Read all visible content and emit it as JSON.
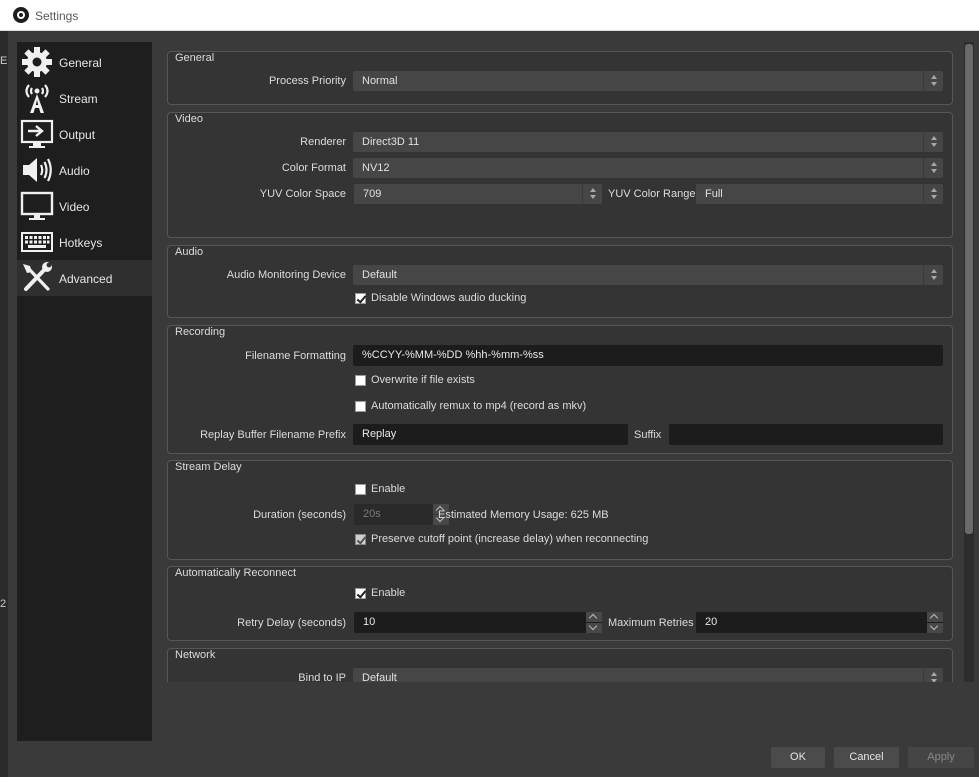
{
  "window": {
    "title": "Settings"
  },
  "edge": [
    "E",
    "2"
  ],
  "sidebar": {
    "items": [
      {
        "label": "General",
        "icon": "gear-icon"
      },
      {
        "label": "Stream",
        "icon": "broadcast-icon"
      },
      {
        "label": "Output",
        "icon": "output-icon"
      },
      {
        "label": "Audio",
        "icon": "speaker-icon"
      },
      {
        "label": "Video",
        "icon": "monitor-icon"
      },
      {
        "label": "Hotkeys",
        "icon": "keyboard-icon"
      },
      {
        "label": "Advanced",
        "icon": "tools-icon"
      }
    ],
    "active": "Advanced"
  },
  "general": {
    "title": "General",
    "process_priority_label": "Process Priority",
    "process_priority_value": "Normal"
  },
  "video": {
    "title": "Video",
    "renderer_label": "Renderer",
    "renderer_value": "Direct3D 11",
    "color_format_label": "Color Format",
    "color_format_value": "NV12",
    "yuv_space_label": "YUV Color Space",
    "yuv_space_value": "709",
    "yuv_range_label": "YUV Color Range",
    "yuv_range_value": "Full"
  },
  "audio": {
    "title": "Audio",
    "monitoring_label": "Audio Monitoring Device",
    "monitoring_value": "Default",
    "ducking_label": "Disable Windows audio ducking",
    "ducking_checked": true
  },
  "recording": {
    "title": "Recording",
    "filename_label": "Filename Formatting",
    "filename_value": "%CCYY-%MM-%DD %hh-%mm-%ss",
    "overwrite_label": "Overwrite if file exists",
    "overwrite_checked": false,
    "remux_label": "Automatically remux to mp4 (record as mkv)",
    "remux_checked": false,
    "replay_prefix_label": "Replay Buffer Filename Prefix",
    "replay_prefix_value": "Replay",
    "suffix_label": "Suffix",
    "suffix_value": ""
  },
  "stream_delay": {
    "title": "Stream Delay",
    "enable_label": "Enable",
    "enable_checked": false,
    "duration_label": "Duration (seconds)",
    "duration_value": "20s",
    "memory_text": "Estimated Memory Usage: 625 MB",
    "preserve_label": "Preserve cutoff point (increase delay) when reconnecting",
    "preserve_checked": true
  },
  "reconnect": {
    "title": "Automatically Reconnect",
    "enable_label": "Enable",
    "enable_checked": true,
    "retry_delay_label": "Retry Delay (seconds)",
    "retry_delay_value": "10",
    "max_retries_label": "Maximum Retries",
    "max_retries_value": "20"
  },
  "network": {
    "title": "Network",
    "bind_label": "Bind to IP",
    "bind_value": "Default"
  },
  "buttons": {
    "ok": "OK",
    "cancel": "Cancel",
    "apply": "Apply"
  }
}
